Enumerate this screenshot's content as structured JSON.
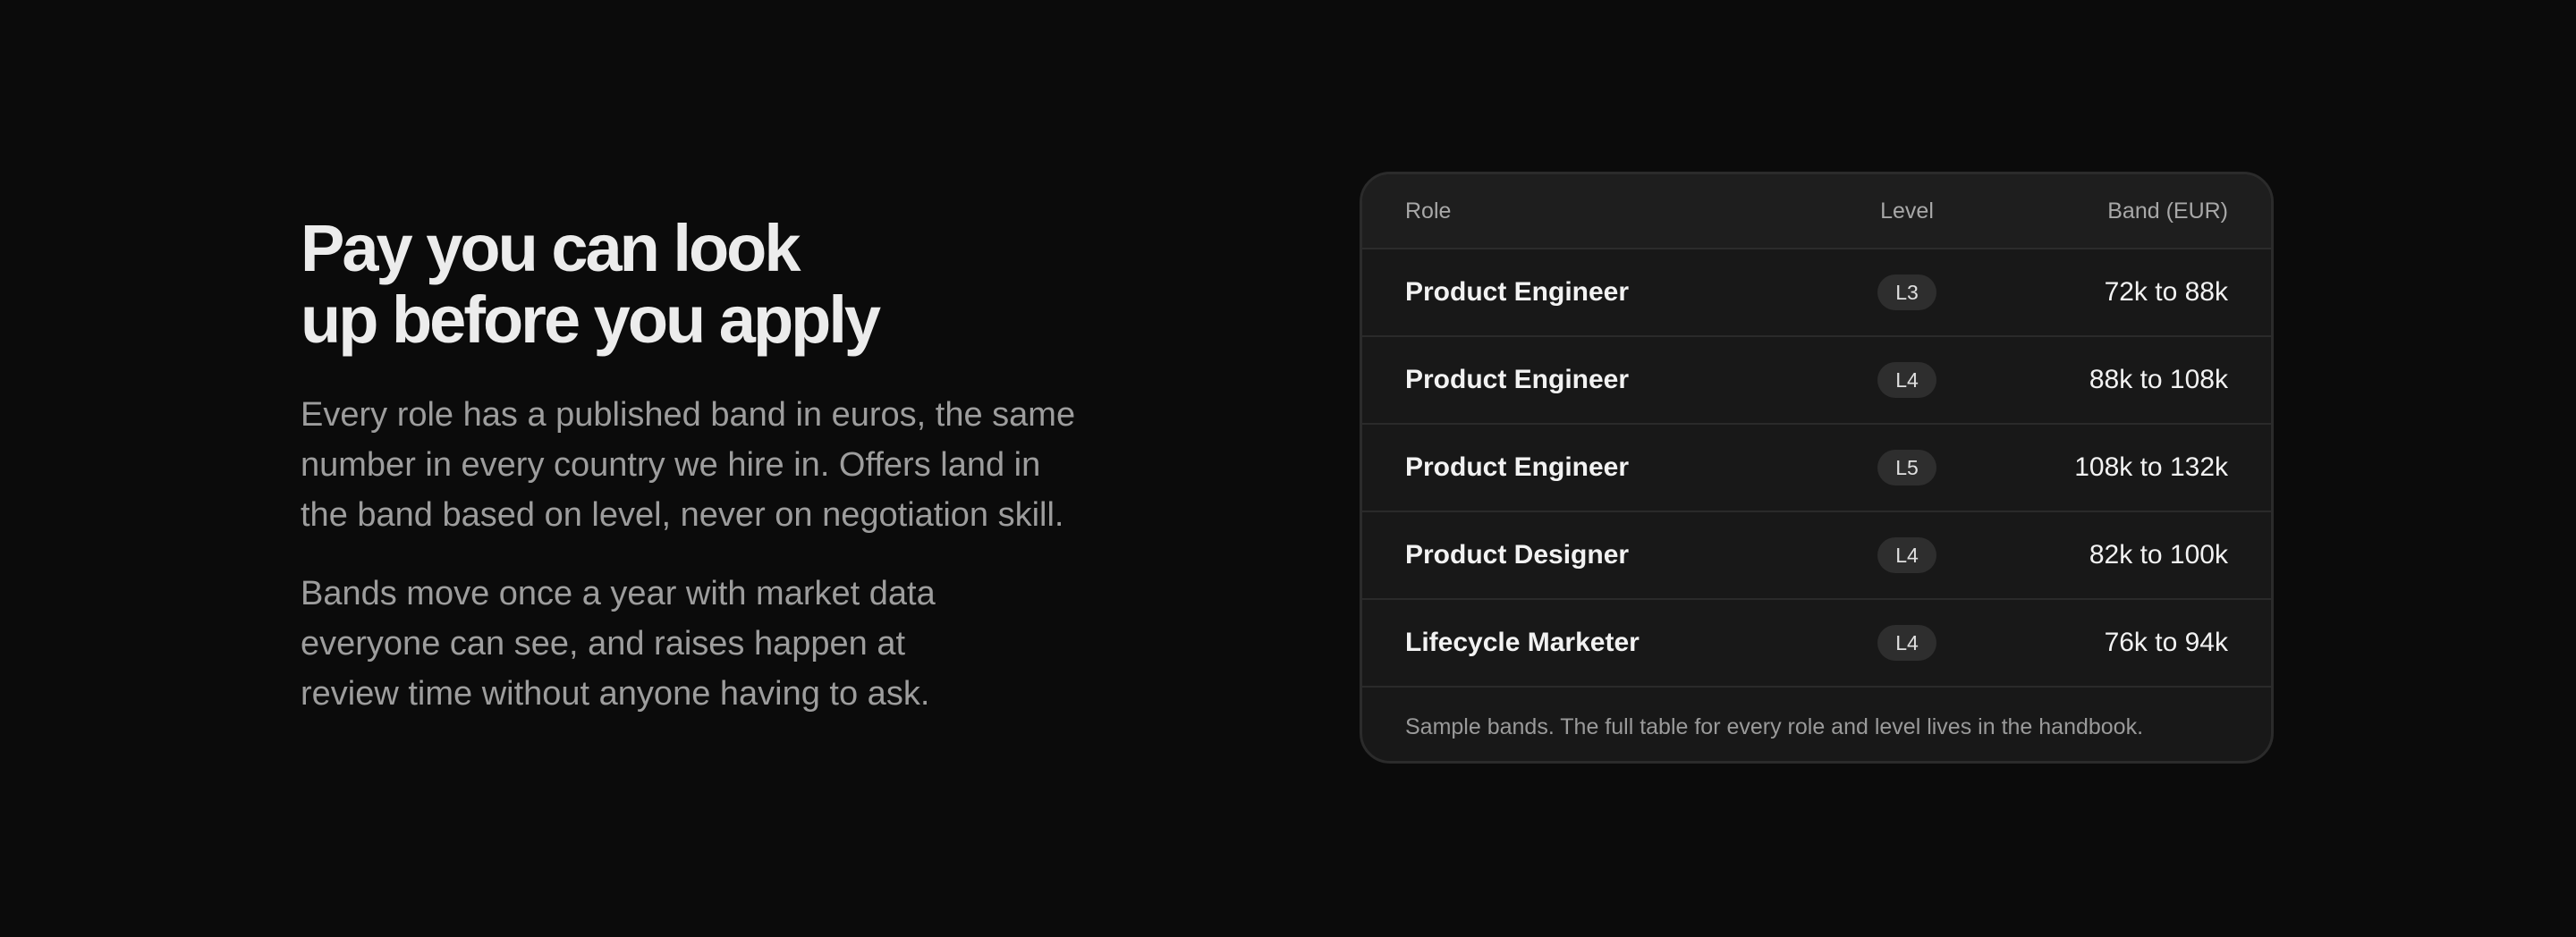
{
  "hero": {
    "headline_line1": "Pay you can look",
    "headline_line2": "up before you apply",
    "paragraph1": "Every role has a published band in euros, the same number in every country we hire in. Offers land in the band based on level, never on negotiation skill.",
    "paragraph2": "Bands move once a year with market data everyone can see, and raises happen at review time without anyone having to ask."
  },
  "table": {
    "headers": {
      "role": "Role",
      "level": "Level",
      "band": "Band (EUR)"
    },
    "rows": [
      {
        "role": "Product Engineer",
        "level": "L3",
        "band": "72k to 88k"
      },
      {
        "role": "Product Engineer",
        "level": "L4",
        "band": "88k to 108k"
      },
      {
        "role": "Product Engineer",
        "level": "L5",
        "band": "108k to 132k"
      },
      {
        "role": "Product Designer",
        "level": "L4",
        "band": "82k to 100k"
      },
      {
        "role": "Lifecycle Marketer",
        "level": "L4",
        "band": "76k to 94k"
      }
    ],
    "footnote": "Sample bands. The full table for every role and level lives in the handbook."
  },
  "colors": {
    "background": "#0b0b0b",
    "card": "#181818",
    "header_row": "#1e1e1e",
    "badge": "#2e2e2e",
    "muted_text": "#9d9d9d"
  }
}
